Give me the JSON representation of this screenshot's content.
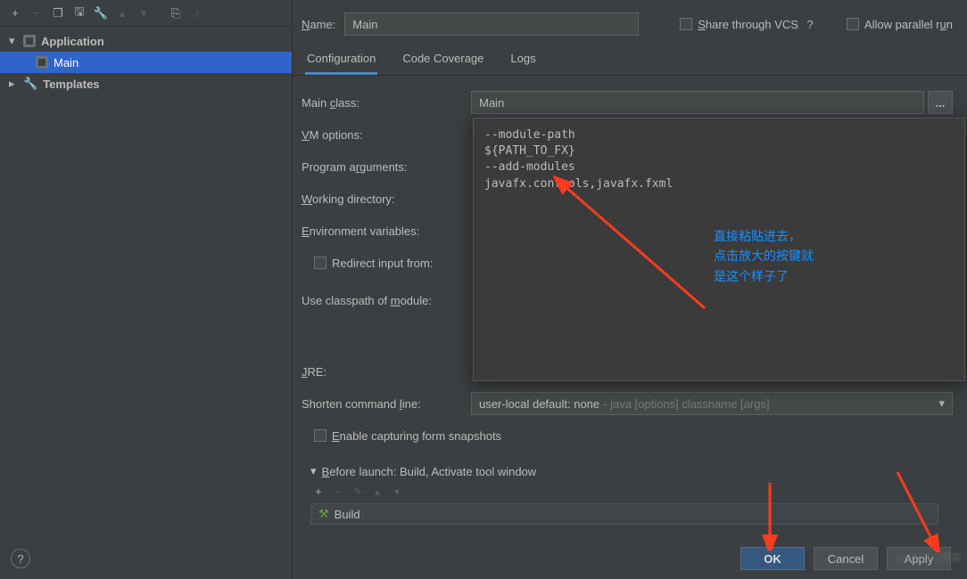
{
  "sidebar": {
    "app_label": "Application",
    "main_label": "Main",
    "templates_label": "Templates"
  },
  "name": {
    "label": "Name:",
    "value": "Main"
  },
  "share_vcs": "Share through VCS",
  "allow_parallel": "Allow parallel run",
  "tabs": [
    "Configuration",
    "Code Coverage",
    "Logs"
  ],
  "form": {
    "main_class": {
      "label": "Main class:",
      "value": "Main"
    },
    "vm_options": "VM options:",
    "prog_args": "Program arguments:",
    "working_dir": "Working directory:",
    "env_vars": "Environment variables:",
    "redirect": "Redirect input from:",
    "classpath": "Use classpath of module:",
    "jre": "JRE:",
    "shorten": {
      "label": "Shorten command line:",
      "value": "user-local default: none",
      "hint": " - java [options] classname [args]"
    },
    "snapshots": "Enable capturing form snapshots"
  },
  "popover": "--module-path\n${PATH_TO_FX}\n--add-modules\njavafx.controls,javafx.fxml",
  "annotation": "直接粘贴进去，\n点击放大的按键就\n是这个样子了",
  "before": {
    "header": "Before launch: Build, Activate tool window",
    "build": "Build"
  },
  "buttons": {
    "ok": "OK",
    "cancel": "Cancel",
    "apply": "Apply"
  },
  "watermark": "@51CTO博客"
}
